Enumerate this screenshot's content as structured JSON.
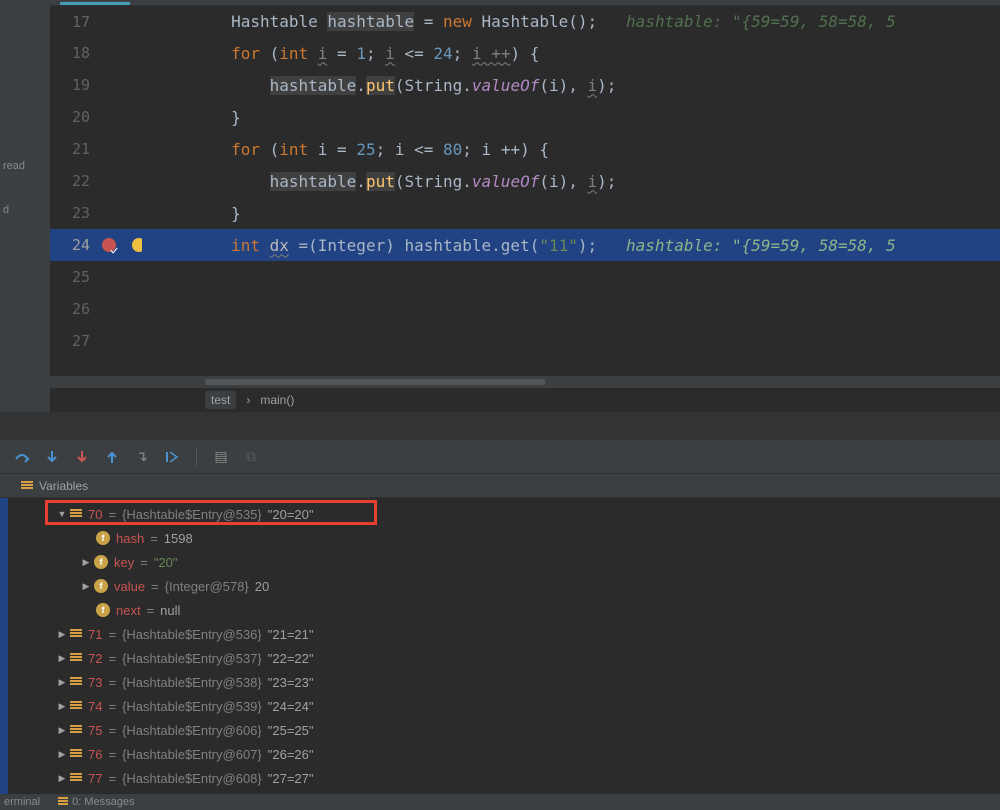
{
  "left_proj": {
    "t1": "read",
    "t2": "d"
  },
  "code_lines": [
    {
      "n": "17"
    },
    {
      "n": "18"
    },
    {
      "n": "19"
    },
    {
      "n": "20"
    },
    {
      "n": "21"
    },
    {
      "n": "22"
    },
    {
      "n": "23"
    },
    {
      "n": "24"
    },
    {
      "n": "25"
    },
    {
      "n": "26"
    },
    {
      "n": "27"
    }
  ],
  "code": {
    "l17": {
      "a": "Hashtable ",
      "b": "hashtable",
      "c": " = ",
      "d": "new",
      "e": " Hashtable();",
      "hint": "hashtable: ",
      "hintval": "\"{59=59, 58=58, 5"
    },
    "l18": {
      "a": "for",
      "b": " (",
      "c": "int",
      "d": " ",
      "e": "i",
      "f": " = ",
      "g": "1",
      "h": "; ",
      "i": "i",
      "j": " <= ",
      "k": "24",
      "l": "; ",
      "m": "i ++",
      "n": ") {"
    },
    "l19": {
      "a": "hashtable",
      "b": ".",
      "c": "put",
      "d": "(String.",
      "e": "valueOf",
      "f": "(i), ",
      "g": "i",
      "h": ");"
    },
    "l20": {
      "a": "}"
    },
    "l21": {
      "a": "for",
      "b": " (",
      "c": "int",
      "d": " i = ",
      "e": "25",
      "f": "; i <= ",
      "g": "80",
      "h": "; i ++) {"
    },
    "l22": {
      "a": "hashtable",
      "b": ".",
      "c": "put",
      "d": "(String.",
      "e": "valueOf",
      "f": "(i), ",
      "g": "i",
      "h": ");"
    },
    "l23": {
      "a": "}"
    },
    "l24": {
      "a": "int",
      "b": " ",
      "c": "dx",
      "d": " =(Integer) hashtable.get(",
      "e": "\"11\"",
      "f": ");",
      "hint": "hashtable: ",
      "hintval": "\"{59=59, 58=58, 5"
    }
  },
  "crumb": {
    "a": "test",
    "b": "›",
    "c": "main()"
  },
  "vars_header": "Variables",
  "vars": {
    "row70": {
      "name": "70",
      "ref": "{Hashtable$Entry@535}",
      "val": "\"20=20\""
    },
    "hash": {
      "name": "hash",
      "val": "1598"
    },
    "key": {
      "name": "key",
      "val": "\"20\""
    },
    "value": {
      "name": "value",
      "ref": "{Integer@578}",
      "val": "20"
    },
    "next": {
      "name": "next",
      "val": "null"
    },
    "row71": {
      "name": "71",
      "ref": "{Hashtable$Entry@536}",
      "val": "\"21=21\""
    },
    "row72": {
      "name": "72",
      "ref": "{Hashtable$Entry@537}",
      "val": "\"22=22\""
    },
    "row73": {
      "name": "73",
      "ref": "{Hashtable$Entry@538}",
      "val": "\"23=23\""
    },
    "row74": {
      "name": "74",
      "ref": "{Hashtable$Entry@539}",
      "val": "\"24=24\""
    },
    "row75": {
      "name": "75",
      "ref": "{Hashtable$Entry@606}",
      "val": "\"25=25\""
    },
    "row76": {
      "name": "76",
      "ref": "{Hashtable$Entry@607}",
      "val": "\"26=26\""
    },
    "row77": {
      "name": "77",
      "ref": "{Hashtable$Entry@608}",
      "val": "\"27=27\""
    }
  },
  "status": {
    "terminal": "erminal",
    "messages": "0: Messages"
  }
}
